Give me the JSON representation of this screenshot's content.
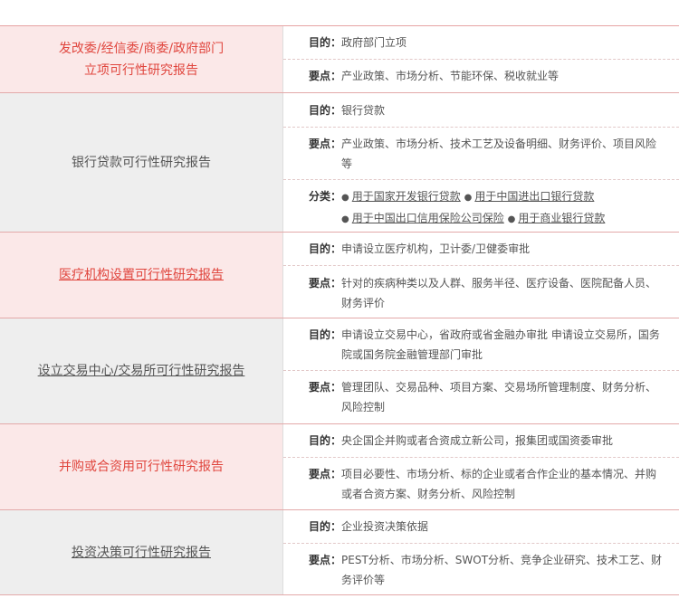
{
  "sep": "：",
  "bullet": "●",
  "groups": [
    {
      "title_lines": [
        "发改委/经信委/商委/政府部门",
        "立项可行性研究报告"
      ],
      "rows": [
        {
          "key": "目的",
          "value": "政府部门立项"
        },
        {
          "key": "要点",
          "value": "产业政策、市场分析、节能环保、税收就业等"
        }
      ]
    },
    {
      "title_lines": [
        "银行贷款可行性研究报告"
      ],
      "rows": [
        {
          "key": "目的",
          "value": "银行贷款"
        },
        {
          "key": "要点",
          "value": "产业政策、市场分析、技术工艺及设备明细、财务评价、项目风险等"
        },
        {
          "key": "分类",
          "links": [
            "用于国家开发银行贷款",
            "用于中国进出口银行贷款",
            "用于中国出口信用保险公司保险",
            "用于商业银行贷款"
          ]
        }
      ]
    },
    {
      "title_lines": [
        "医疗机构设置可行性研究报告"
      ],
      "rows": [
        {
          "key": "目的",
          "value": "申请设立医疗机构，卫计委/卫健委审批"
        },
        {
          "key": "要点",
          "value": "针对的疾病种类以及人群、服务半径、医疗设备、医院配备人员、财务评价"
        }
      ]
    },
    {
      "title_lines": [
        "设立交易中心/交易所可行性研究报告"
      ],
      "rows": [
        {
          "key": "目的",
          "value": "申请设立交易中心，省政府或省金融办审批 申请设立交易所，国务院或国务院金融管理部门审批"
        },
        {
          "key": "要点",
          "value": "管理团队、交易品种、项目方案、交易场所管理制度、财务分析、风险控制"
        }
      ]
    },
    {
      "title_lines": [
        "并购或合资用可行性研究报告"
      ],
      "rows": [
        {
          "key": "目的",
          "value": "央企国企并购或者合资成立新公司，报集团或国资委审批"
        },
        {
          "key": "要点",
          "value": "项目必要性、市场分析、标的企业或者合作企业的基本情况、并购或者合资方案、财务分析、风险控制"
        }
      ]
    },
    {
      "title_lines": [
        "投资决策可行性研究报告"
      ],
      "rows": [
        {
          "key": "目的",
          "value": "企业投资决策依据"
        },
        {
          "key": "要点",
          "value": "PEST分析、市场分析、SWOT分析、竞争企业研究、技术工艺、财务评价等"
        }
      ]
    }
  ]
}
